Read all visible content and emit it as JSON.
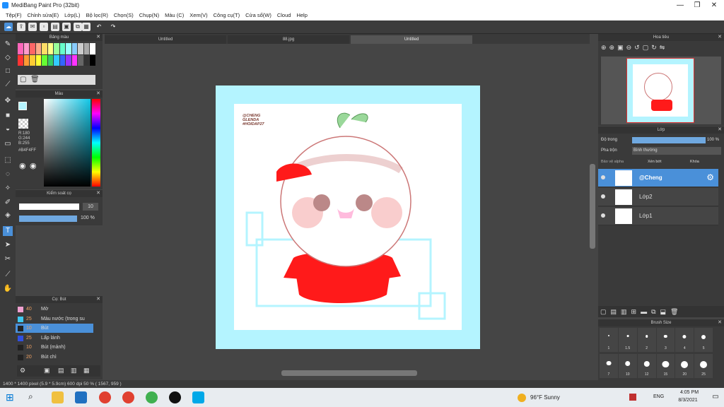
{
  "window": {
    "title": "MediBang Paint Pro (32bit)",
    "min": "—",
    "max": "❐",
    "close": "✕"
  },
  "menu": [
    "Tệp(F)",
    "Chỉnh sửa(E)",
    "Lớp(L)",
    "Bộ lọc(R)",
    "Chọn(S)",
    "Chụp(N)",
    "Màu (C)",
    "Xem(V)",
    "Công cụ(T)",
    "Cửa sổ(W)",
    "Cloud",
    "Help"
  ],
  "doc_tabs": [
    "Untitled",
    "88.jpg",
    "Untitled"
  ],
  "panels": {
    "palette": "Bảng màu",
    "color": "Màu",
    "rgb": {
      "r": "R:180",
      "g": "G:244",
      "b": "B:255",
      "hex": "#B4F4FF"
    },
    "brush_control": "Kiểm soát cọ",
    "brush_size": "10",
    "brush_opacity": "100 %",
    "brush_list": "Cọ: Bút",
    "navigator": "Hoa tiêu",
    "layers": "Lớp",
    "opacity_label": "Độ trong",
    "opacity_value": "100 %",
    "blend_label": "Pha trộn",
    "blend_value": "Bình thường",
    "protect_alpha": "Bảo vệ alpha",
    "clipping": "Xén bớt",
    "lock": "Khóa",
    "brush_size_panel": "Brush Size"
  },
  "brushes": [
    {
      "size": "40",
      "name": "Mờ",
      "color": "#f0a0d0"
    },
    {
      "size": "25",
      "name": "Màu nước (trong su",
      "color": "#40c8f0"
    },
    {
      "size": "10",
      "name": "Bút",
      "color": "#222222"
    },
    {
      "size": "25",
      "name": "Lấp lánh",
      "color": "#3050e0"
    },
    {
      "size": "10",
      "name": "Bút (mảnh)",
      "color": "#222222"
    },
    {
      "size": "20",
      "name": "Bút chì",
      "color": "#222222"
    }
  ],
  "layers_list": [
    {
      "name": "@Cheng",
      "selected": true
    },
    {
      "name": "Lớp2",
      "selected": false
    },
    {
      "name": "Lớp1",
      "selected": false
    }
  ],
  "brush_sizes": [
    "1",
    "1.5",
    "2",
    "3",
    "4",
    "5",
    "7",
    "10",
    "12",
    "15",
    "20",
    "25"
  ],
  "canvas_text": [
    "@CHENG",
    "GLENDA",
    "#HOIDAP27"
  ],
  "status": "1400 * 1400 pixel   (5.9 * 5.9cm)  600 dpi   50 %   ( 1567, 959 )",
  "taskbar": {
    "weather": "96°F  Sunny",
    "lang": "ENG",
    "time": "4:05 PM",
    "date": "8/3/2021"
  },
  "colors": {
    "accent": "#4a90d9",
    "sky": "#b4f4ff",
    "red": "#ff1a1a"
  }
}
